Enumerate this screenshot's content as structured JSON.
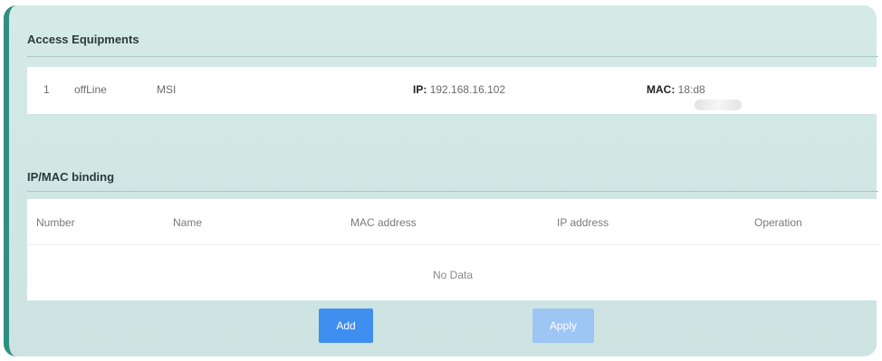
{
  "access_equipments": {
    "title": "Access Equipments",
    "rows": [
      {
        "index": "1",
        "status": "offLine",
        "name": "MSI",
        "ip_label": "IP:",
        "ip_value": "192.168.16.102",
        "mac_label": "MAC:",
        "mac_prefix": "18:",
        "mac_suffix": "d8"
      }
    ]
  },
  "ip_mac_binding": {
    "title": "IP/MAC binding",
    "columns": [
      "Number",
      "Name",
      "MAC address",
      "IP address",
      "Operation"
    ],
    "empty_text": "No Data"
  },
  "buttons": {
    "add_label": "Add",
    "apply_label": "Apply"
  },
  "colors": {
    "frame_accent": "#2f8f80",
    "primary_button": "#3e8ef0",
    "disabled_button": "#9ec6f4"
  }
}
